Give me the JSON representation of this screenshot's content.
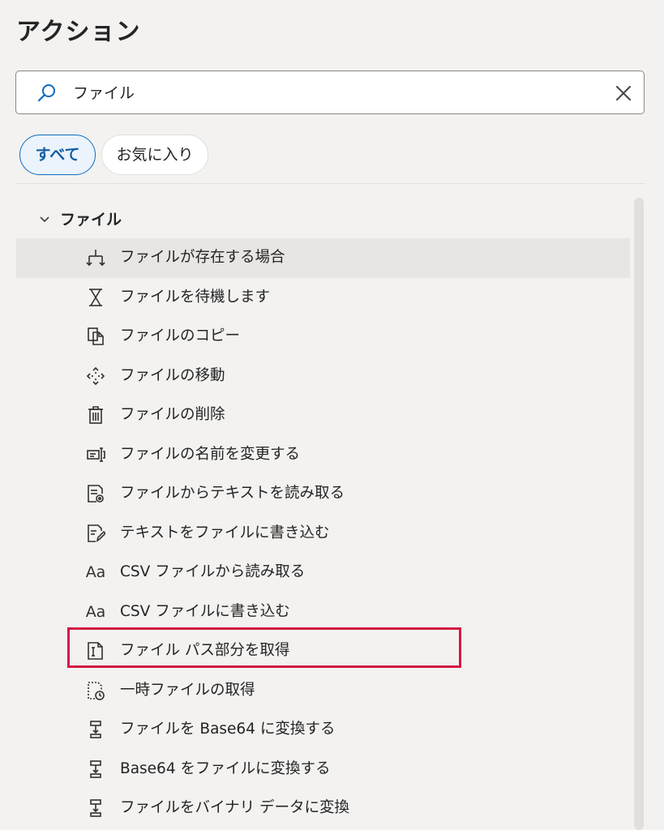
{
  "panel": {
    "title": "アクション"
  },
  "search": {
    "value": "ファイル",
    "search_icon": "search-icon",
    "clear_icon": "close-icon"
  },
  "filters": [
    {
      "label": "すべて",
      "selected": true
    },
    {
      "label": "お気に入り",
      "selected": false
    }
  ],
  "group": {
    "label": "ファイル",
    "expanded": true,
    "items": [
      {
        "label": "ファイルが存在する場合",
        "icon": "branch-icon",
        "hovered": true
      },
      {
        "label": "ファイルを待機します",
        "icon": "hourglass-icon"
      },
      {
        "label": "ファイルのコピー",
        "icon": "copy-icon"
      },
      {
        "label": "ファイルの移動",
        "icon": "move-icon"
      },
      {
        "label": "ファイルの削除",
        "icon": "trash-icon"
      },
      {
        "label": "ファイルの名前を変更する",
        "icon": "rename-icon"
      },
      {
        "label": "ファイルからテキストを読み取る",
        "icon": "read-text-icon"
      },
      {
        "label": "テキストをファイルに書き込む",
        "icon": "write-text-icon"
      },
      {
        "label": "CSV ファイルから読み取る",
        "icon": "font-icon",
        "glyph": "Aa"
      },
      {
        "label": "CSV ファイルに書き込む",
        "icon": "font-icon",
        "glyph": "Aa"
      },
      {
        "label": "ファイル パス部分を取得",
        "icon": "file-path-icon",
        "highlighted": true
      },
      {
        "label": "一時ファイルの取得",
        "icon": "temp-file-icon"
      },
      {
        "label": "ファイルを Base64 に変換する",
        "icon": "convert-icon"
      },
      {
        "label": "Base64 をファイルに変換する",
        "icon": "convert-icon"
      },
      {
        "label": "ファイルをバイナリ データに変換",
        "icon": "convert-icon"
      }
    ]
  },
  "colors": {
    "accent": "#0f6cbd",
    "highlight_border": "#d41942",
    "panel_background": "#f3f2f1"
  }
}
